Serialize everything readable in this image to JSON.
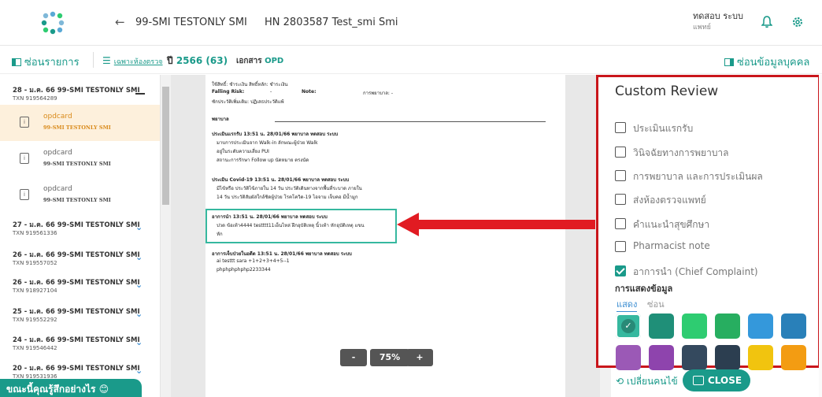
{
  "header": {
    "back_icon": "arrow-left",
    "patient_name": "99-SMI TESTONLY SMI",
    "hn": "HN 2803587 Test_smi Smi",
    "user_name": "ทดสอบ ระบบ",
    "user_role": "แพทย์"
  },
  "toolbar": {
    "hide_list": "ซ่อนรายการ",
    "filter": "เฉพาะห้องตรวจ",
    "year_prefix": "ปี",
    "year": "2566 (63)",
    "doc_label": "เอกสาร",
    "doc_type": "OPD",
    "hide_personal": "ซ่อนข้อมูลบุคคล"
  },
  "visits": [
    {
      "title": "28 - ม.ค. 66 99-SMI TESTONLY SMI",
      "txn": "TXN 919564289"
    },
    {
      "title": "27 - ม.ค. 66 99-SMI TESTONLY SMI",
      "txn": "TXN 919561336"
    },
    {
      "title": "26 - ม.ค. 66 99-SMI TESTONLY SMI",
      "txn": "TXN 919557052"
    },
    {
      "title": "26 - ม.ค. 66 99-SMI TESTONLY SMI",
      "txn": "TXN 918927104"
    },
    {
      "title": "25 - ม.ค. 66 99-SMI TESTONLY SMI",
      "txn": "TXN 919552292"
    },
    {
      "title": "24 - ม.ค. 66 99-SMI TESTONLY SMI",
      "txn": "TXN 919546442"
    },
    {
      "title": "20 - ม.ค. 66 99-SMI TESTONLY SMI",
      "txn": "TXN 919531936"
    }
  ],
  "cards": [
    {
      "label": "opdcard",
      "sub": "99-SMI TESTONLY SMI"
    },
    {
      "label": "opdcard",
      "sub": "99-SMI TESTONLY SMI"
    },
    {
      "label": "opdcard",
      "sub": "99-SMI TESTONLY SMI"
    }
  ],
  "feedback": "ขณะนี้คุณรู้สึกอย่างไร 😊",
  "document": {
    "l1": "ใช้สิทธิ์: ชำระเงิน   สิทธิ์หลัก: ชำระเงิน",
    "l2a": "Falling Risk:",
    "l2b": "-",
    "l2c": "Note:",
    "l2d": "การพยาบาล: -",
    "l3": "ซักประวัติเพิ่มเติม: ปฏิเสธประวัติแพ้",
    "section": "พยาบาล",
    "p1": "ประเมินแรกรับ  13:51 น. 28/01/66 พยาบาล ทดสอบ ระบบ",
    "p2": "มาบการประเมินจาก Walk-in  ลักษณะผู้ป่วย Walk",
    "p3": "อยู่ในระดับความเสี่ยง PUI",
    "p4": "สถานะการรักษา Follow up  นัดหมาย ตรงนัด",
    "c1": "ประเมิน Covid-19  13:51 น. 28/01/66 พยาบาล ทดสอบ ระบบ",
    "c2": "มีไข้หรือ ประวัติไข้ภายใน 14 วัน ประวัติเดินทางจากพื้นที่ระบาด ภายใน",
    "c3": "14 วัน ประวัติสัมผัสใกล้ชิดผู้ป่วย โรคโควิด-19 ไอจาม เจ็บคอ มีน้ำมูก",
    "g1": "อาการนำ  13:51 น. 28/01/66 พยาบาล ทดสอบ ระบบ",
    "g2": "ปวด ข้อเท้า4444 testttt11เอ็นไหล่ ฝึกอุบัติเหตุ นิ้วเท้า หักอุบัติเหตุ แขน",
    "g3": "หัก",
    "e1": "อาการเจ็บป่วยในอดีต  13:51 น. 28/01/66 พยาบาล ทดสอบ ระบบ",
    "e2": "ai testtt sara +1+2+3+4+5--1",
    "e3": "phphphphphp2233344"
  },
  "zoom": {
    "minus": "-",
    "level": "75%",
    "plus": "+"
  },
  "panel": {
    "title": "Custom Review",
    "items": [
      {
        "label": "ประเมินแรกรับ",
        "checked": false
      },
      {
        "label": "วินิจฉัยทางการพยาบาล",
        "checked": false
      },
      {
        "label": "การพยาบาล และการประเมินผล",
        "checked": false
      },
      {
        "label": "ส่งห้องตรวจแพทย์",
        "checked": false
      },
      {
        "label": "คำแนะนำสุขศึกษา",
        "checked": false
      },
      {
        "label": "Pharmacist note",
        "checked": false
      },
      {
        "label": "อาการนำ (Chief Complaint)",
        "checked": true
      }
    ],
    "display_label": "การแสดงข้อมูล",
    "show": "แสดง",
    "hide": "ซ่อน",
    "colors": [
      "#36b89f",
      "#1f8f78",
      "#2ecc71",
      "#27ae60",
      "#3498db",
      "#2980b9",
      "#9b59b6",
      "#8e44ad",
      "#34495e",
      "#2c3e50",
      "#f1c40f",
      "#f39c12"
    ]
  },
  "bottom": {
    "swap": "เปลี่ยนคนไข้",
    "close": "CLOSE"
  },
  "colors": {
    "accent": "#1a9a8a",
    "highlight": "#c9161b"
  }
}
